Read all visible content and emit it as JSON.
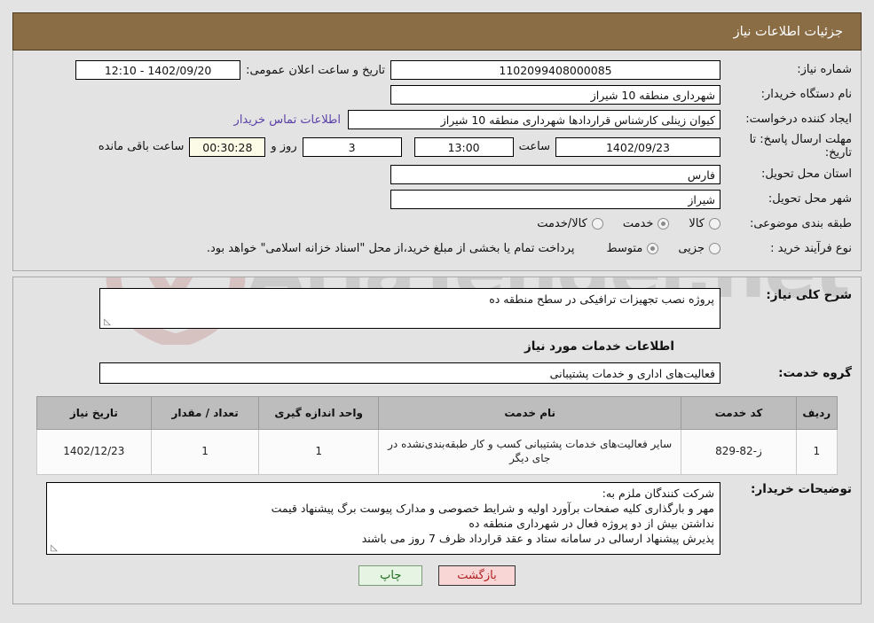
{
  "header": {
    "title": "جزئیات اطلاعات نیاز"
  },
  "form": {
    "need_number_label": "شماره نیاز:",
    "need_number_value": "1102099408000085",
    "publish_label": "تاریخ و ساعت اعلان عمومی:",
    "publish_value": "1402/09/20 - 12:10",
    "buyer_org_label": "نام دستگاه خریدار:",
    "buyer_org_value": "شهرداری منطقه 10 شیراز",
    "creator_label": "ایجاد کننده درخواست:",
    "creator_value": "کیوان زینلی کارشناس قراردادها شهرداری منطقه 10 شیراز",
    "contact_link": "اطلاعات تماس خریدار",
    "deadline_label": "مهلت ارسال پاسخ: تا تاریخ:",
    "deadline_date": "1402/09/23",
    "hour_label": "ساعت",
    "hour_value": "13:00",
    "days_value": "3",
    "days_and": "روز و",
    "countdown_value": "00:30:28",
    "remaining_label": "ساعت باقی مانده",
    "province_label": "استان محل تحویل:",
    "province_value": "فارس",
    "city_label": "شهر محل تحویل:",
    "city_value": "شیراز",
    "category_label": "طبقه بندی موضوعی:",
    "category_options": [
      {
        "label": "کالا",
        "checked": false
      },
      {
        "label": "خدمت",
        "checked": true
      },
      {
        "label": "کالا/خدمت",
        "checked": false
      }
    ],
    "process_label": "نوع فرآیند خرید :",
    "process_options": [
      {
        "label": "جزیی",
        "checked": false
      },
      {
        "label": "متوسط",
        "checked": true
      }
    ],
    "process_note": "پرداخت تمام یا بخشی از مبلغ خرید،از محل \"اسناد خزانه اسلامی\" خواهد بود."
  },
  "details": {
    "general_desc_label": "شرح کلی نیاز:",
    "general_desc_value": "پروژه نصب تجهیزات ترافیکی در سطح منطقه ده",
    "services_heading": "اطلاعات خدمات مورد نیاز",
    "service_group_label": "گروه خدمت:",
    "service_group_value": "فعالیت‌های اداری و خدمات پشتیبانی"
  },
  "table": {
    "headers": [
      "ردیف",
      "کد خدمت",
      "نام خدمت",
      "واحد اندازه گیری",
      "تعداد / مقدار",
      "تاریخ نیاز"
    ],
    "rows": [
      {
        "radif": "1",
        "code": "ز-82-829",
        "name": "سایر فعالیت‌های خدمات پشتیبانی کسب و کار طبقه‌بندی‌نشده در جای دیگر",
        "unit": "1",
        "qty": "1",
        "date": "1402/12/23"
      }
    ]
  },
  "notes": {
    "label": "توضیحات خریدار:",
    "lines": [
      "شرکت کنندگان ملزم به:",
      "مهر و بارگذاری کلیه صفحات برآورد اولیه و شرایط خصوصی و مدارک پیوست برگ پیشنهاد قیمت",
      "نداشتن بیش از دو پروژه فعال در شهرداری منطقه ده",
      "پذیرش پیشنهاد ارسالی در سامانه ستاد و عقد قرارداد ظرف 7 روز می باشند"
    ]
  },
  "footer": {
    "print_label": "چاپ",
    "back_label": "بازگشت"
  },
  "watermark": {
    "text": "AriaTender.net"
  },
  "colors": {
    "header_bg": "#8a6d45",
    "link": "#5b3fa8",
    "countdown_bg": "#fbfbe8",
    "print_bg": "#e6f5e3",
    "back_bg": "#f9d6d6"
  }
}
